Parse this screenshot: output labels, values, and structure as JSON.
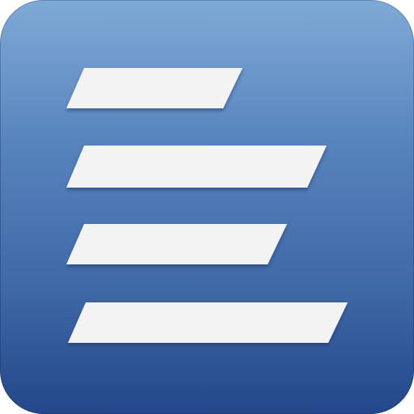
{
  "app_icon": {
    "icon_name": "text-lines-icon",
    "colors": {
      "background_top": "#709fd1",
      "background_bottom": "#23478a",
      "bars": "#f3f3f3",
      "bar_shadow": "#1a3466"
    },
    "bar_count": 4
  }
}
